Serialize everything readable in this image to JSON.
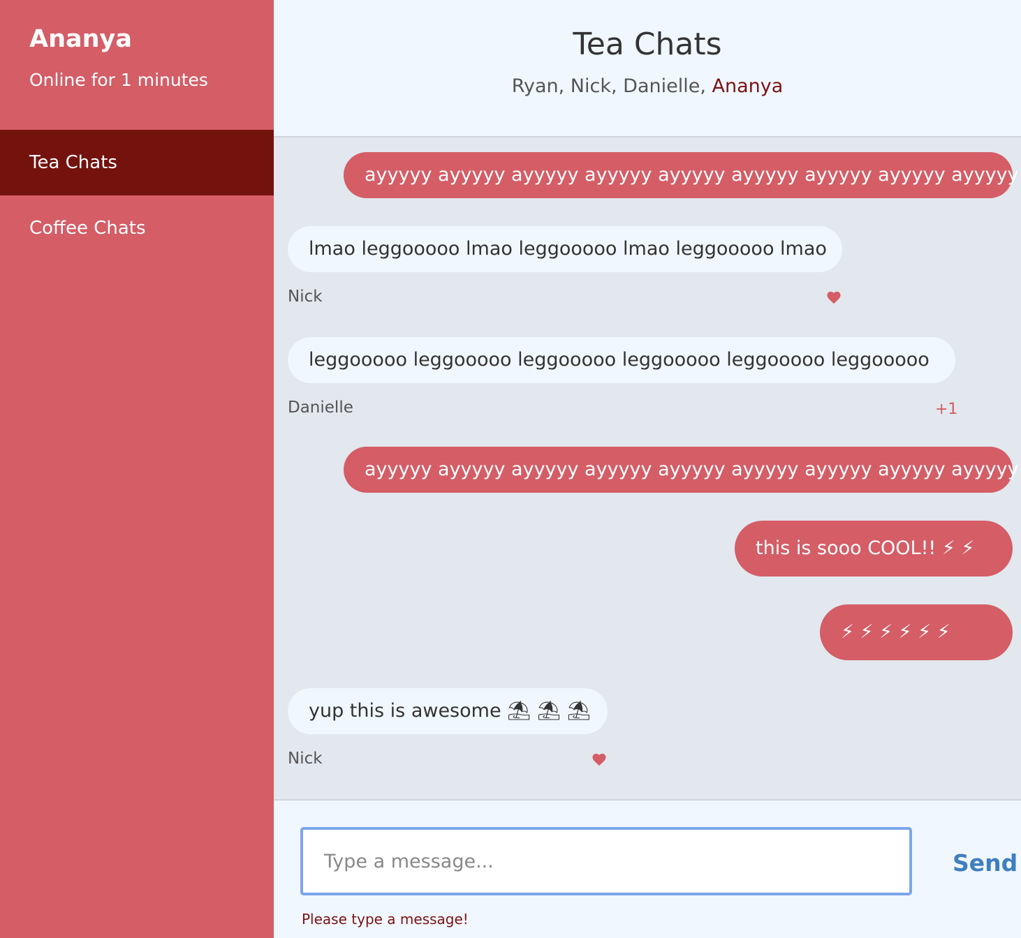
{
  "user": {
    "name": "Ananya",
    "status": "Online for 1 minutes"
  },
  "channels": [
    {
      "label": "Tea Chats",
      "active": true
    },
    {
      "label": "Coffee Chats",
      "active": false
    }
  ],
  "header": {
    "title": "Tea Chats",
    "members_others": "Ryan, Nick, Danielle, ",
    "member_me": "Ananya"
  },
  "messages": [
    {
      "text": "ayyyyy ayyyyy ayyyyy ayyyyy ayyyyy ayyyyy ayyyyy ayyyyy ayyyyy",
      "mine": true
    },
    {
      "text": "lmao leggooooo lmao leggooooo lmao leggooooo lmao",
      "mine": false,
      "sender": "Nick",
      "reaction": "heart"
    },
    {
      "text": "leggooooo leggooooo leggooooo leggooooo leggooooo leggooooo",
      "mine": false,
      "sender": "Danielle",
      "reaction": "+1"
    },
    {
      "text": "ayyyyy ayyyyy ayyyyy ayyyyy ayyyyy ayyyyy ayyyyy ayyyyy ayyyyy",
      "mine": true
    },
    {
      "text": "this is sooo COOL!! ⚡ ⚡",
      "mine": true
    },
    {
      "text": "⚡ ⚡ ⚡ ⚡ ⚡ ⚡",
      "mine": true
    },
    {
      "text": "yup this is awesome ⛱ ⛱ ⛱",
      "mine": false,
      "sender": "Nick",
      "reaction": "heart"
    }
  ],
  "composer": {
    "placeholder": "Type a message...",
    "send_label": "Send",
    "error": "Please type a message!"
  },
  "colors": {
    "accent": "#d45d66",
    "active_channel": "#74120e",
    "send": "#3f7fc0"
  }
}
